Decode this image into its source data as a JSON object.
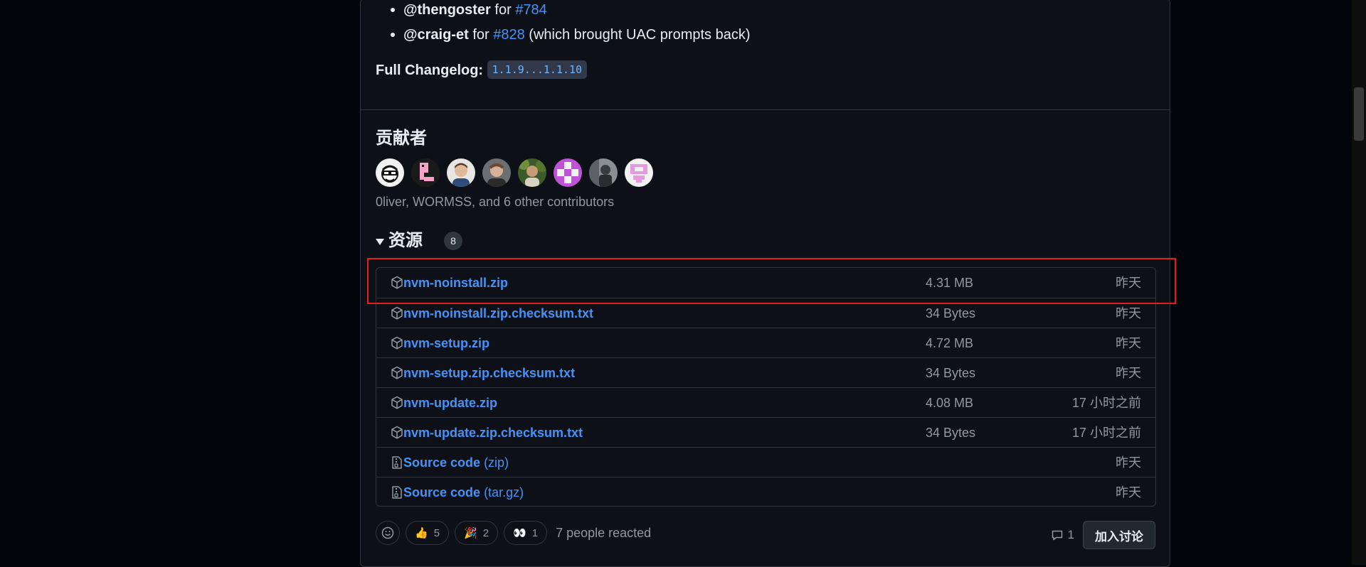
{
  "mentions": [
    {
      "user": "@thengoster",
      "connector": "for",
      "ref": "#784",
      "note": ""
    },
    {
      "user": "@craig-et",
      "connector": "for",
      "ref": "#828",
      "note": "(which brought UAC prompts back)"
    }
  ],
  "changelog": {
    "label": "Full Changelog:",
    "range": "1.1.9...1.1.10"
  },
  "contributors": {
    "title": "贡献者",
    "summary": "0liver, WORMSS, and 6 other contributors",
    "avatars": [
      "avatar-1",
      "avatar-2",
      "avatar-3",
      "avatar-4",
      "avatar-5",
      "avatar-6",
      "avatar-7",
      "avatar-8"
    ]
  },
  "assets": {
    "title": "资源",
    "count": "8",
    "items": [
      {
        "name": "nvm-noinstall.zip",
        "suffix": "",
        "size": "4.31 MB",
        "date": "昨天",
        "icon": "package-icon"
      },
      {
        "name": "nvm-noinstall.zip.checksum.txt",
        "suffix": "",
        "size": "34 Bytes",
        "date": "昨天",
        "icon": "package-icon"
      },
      {
        "name": "nvm-setup.zip",
        "suffix": "",
        "size": "4.72 MB",
        "date": "昨天",
        "icon": "package-icon"
      },
      {
        "name": "nvm-setup.zip.checksum.txt",
        "suffix": "",
        "size": "34 Bytes",
        "date": "昨天",
        "icon": "package-icon"
      },
      {
        "name": "nvm-update.zip",
        "suffix": "",
        "size": "4.08 MB",
        "date": "17 小时之前",
        "icon": "package-icon"
      },
      {
        "name": "nvm-update.zip.checksum.txt",
        "suffix": "",
        "size": "34 Bytes",
        "date": "17 小时之前",
        "icon": "package-icon"
      },
      {
        "name": "Source code",
        "suffix": "(zip)",
        "size": "",
        "date": "昨天",
        "icon": "file-zip-icon"
      },
      {
        "name": "Source code",
        "suffix": "(tar.gz)",
        "size": "",
        "date": "昨天",
        "icon": "file-zip-icon"
      }
    ]
  },
  "reactions": {
    "items": [
      {
        "emoji": "👍",
        "count": "5"
      },
      {
        "emoji": "🎉",
        "count": "2"
      },
      {
        "emoji": "👀",
        "count": "1"
      }
    ],
    "summary": "7 people reacted"
  },
  "discussion": {
    "comment_count": "1",
    "button_label": "加入讨论"
  },
  "colors": {
    "link": "#4493f8",
    "highlight": "#e0201c",
    "background": "#0d1117"
  }
}
